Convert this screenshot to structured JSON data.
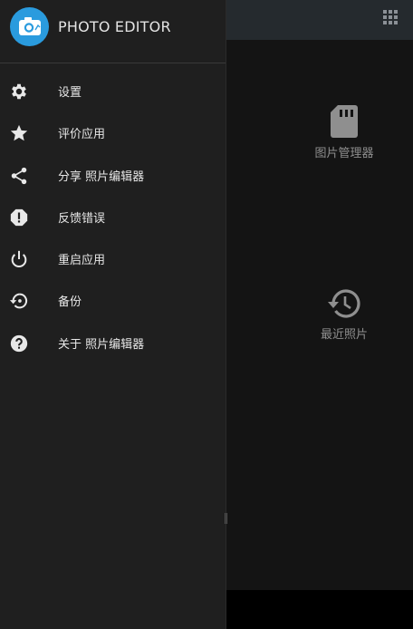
{
  "app": {
    "title": "PHOTO EDITOR"
  },
  "drawer": {
    "items": [
      {
        "label": "设置",
        "icon": "gear-icon"
      },
      {
        "label": "评价应用",
        "icon": "star-icon"
      },
      {
        "label": "分享 照片编辑器",
        "icon": "share-icon"
      },
      {
        "label": "反馈错误",
        "icon": "alert-icon"
      },
      {
        "label": "重启应用",
        "icon": "power-icon"
      },
      {
        "label": "备份",
        "icon": "restore-icon"
      },
      {
        "label": "关于 照片编辑器",
        "icon": "help-icon"
      }
    ]
  },
  "main": {
    "tiles": [
      {
        "label": "图片管理器",
        "icon": "sd-card-icon"
      },
      {
        "label": "最近照片",
        "icon": "history-icon"
      }
    ]
  },
  "colors": {
    "accent": "#2a9bde",
    "drawer_bg": "#1f1f1f",
    "text": "#e8e8e8"
  }
}
